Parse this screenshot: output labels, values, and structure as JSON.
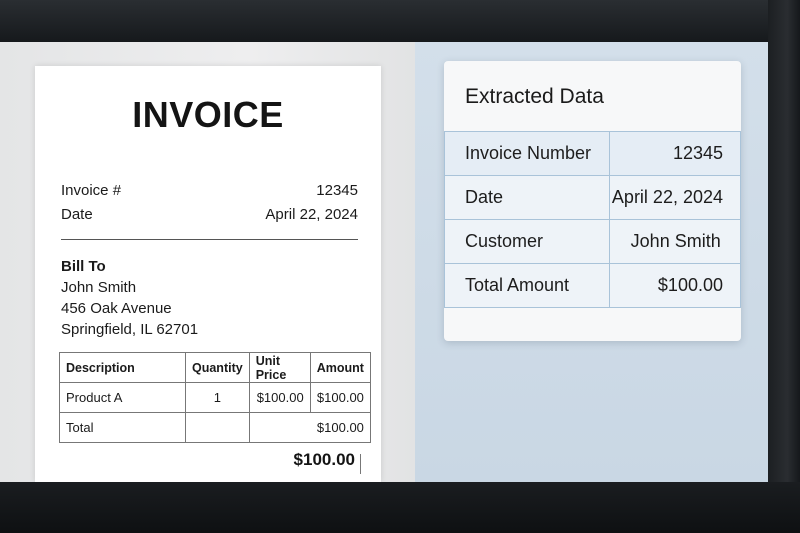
{
  "invoice": {
    "title": "INVOICE",
    "number_label": "Invoice #",
    "number_value": "12345",
    "date_label": "Date",
    "date_value": "April 22, 2024",
    "bill_to_label": "Bill To",
    "bill_to_name": "John Smith",
    "bill_to_street": "456 Oak Avenue",
    "bill_to_city": "Springfield, IL 62701",
    "table": {
      "headers": [
        "Description",
        "Quantity",
        "Unit Price",
        "Amount"
      ],
      "rows": [
        [
          "Product A",
          "1",
          "$100.00",
          "$100.00"
        ]
      ],
      "total_label": "Total",
      "total_value": "$100.00"
    },
    "grand_total": "$100.00"
  },
  "extracted": {
    "title": "Extracted Data",
    "rows": [
      {
        "key": "Invoice Number",
        "value": "12345"
      },
      {
        "key": "Date",
        "value": "April 22, 2024"
      },
      {
        "key": "Customer",
        "value": "John Smith"
      },
      {
        "key": "Total Amount",
        "value": "$100.00"
      }
    ]
  },
  "colors": {
    "extracted_border": "#a9c3d9",
    "right_pane": "#cfdce8"
  }
}
